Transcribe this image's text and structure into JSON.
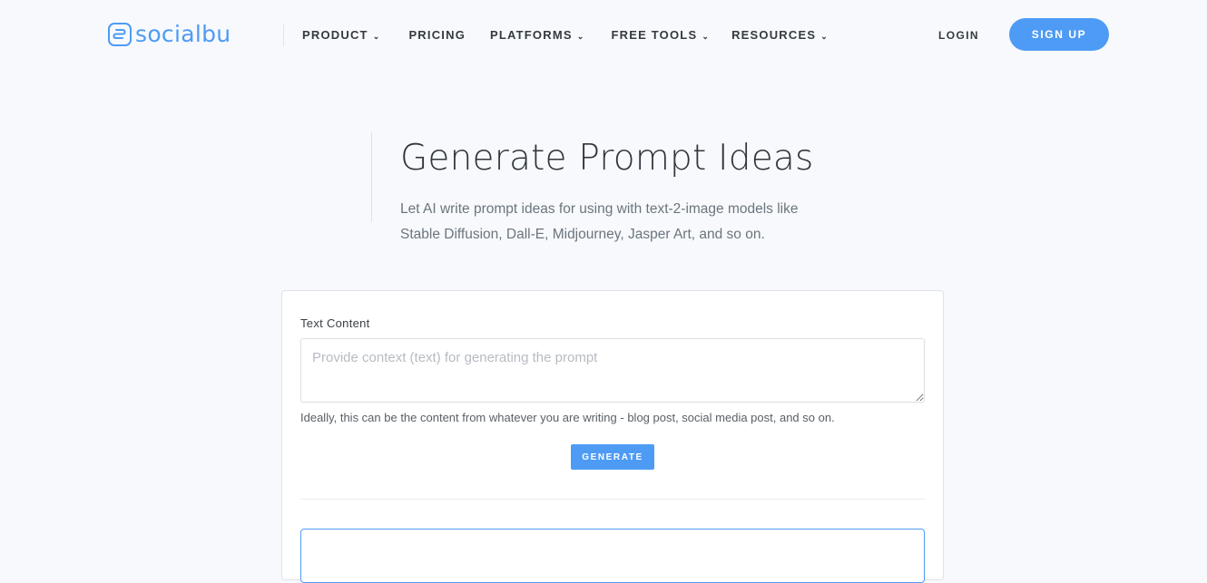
{
  "brand": {
    "name": "socialbu",
    "accent": "#4e9bf5"
  },
  "nav": {
    "items": [
      {
        "label": "PRODUCT",
        "has_dropdown": true
      },
      {
        "label": "PRICING",
        "has_dropdown": false
      },
      {
        "label": "PLATFORMS",
        "has_dropdown": true
      },
      {
        "label": "FREE TOOLS",
        "has_dropdown": true
      },
      {
        "label": "RESOURCES",
        "has_dropdown": true
      }
    ],
    "dropdown_icon": "chevron-down-icon",
    "chevron": "⌄",
    "login_label": "LOGIN",
    "signup_label": "SIGN UP"
  },
  "hero": {
    "title": "Generate Prompt Ideas",
    "subtitle": "Let AI write prompt ideas for using with text-2-image models like Stable Diffusion, Dall-E, Midjourney, Jasper Art, and so on."
  },
  "form": {
    "field_label": "Text Content",
    "textarea_value": "",
    "textarea_placeholder": "Provide context (text) for generating the prompt",
    "hint": "Ideally, this can be the content from whatever you are writing - blog post, social media post, and so on.",
    "generate_label": "GENERATE",
    "output_value": ""
  }
}
